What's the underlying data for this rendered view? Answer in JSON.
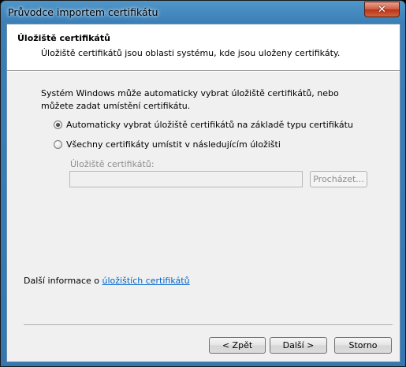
{
  "window": {
    "title": "Průvodce importem certifikátu",
    "close_symbol": "✕",
    "close_icon": "close-icon"
  },
  "header": {
    "title": "Úložiště certifikátů",
    "description": "Úložiště certifikátů jsou oblasti systému, kde jsou uloženy certifikáty."
  },
  "body": {
    "intro": "Systém Windows může automaticky vybrat úložiště certifikátů, nebo můžete zadat umístění certifikátu.",
    "options": [
      {
        "label": "Automaticky vybrat úložiště certifikátů na základě typu certifikátu",
        "selected": true
      },
      {
        "label": "Všechny certifikáty umístit v následujícím úložišti",
        "selected": false
      }
    ],
    "store_field": {
      "label": "Úložiště certifikátů:",
      "value": "",
      "enabled": false
    },
    "browse_button": "Procházet...",
    "more_info_prefix": "Další informace o ",
    "more_info_link": "úložištích certifikátů"
  },
  "footer": {
    "back": "< Zpět",
    "next": "Další >",
    "cancel": "Storno"
  }
}
